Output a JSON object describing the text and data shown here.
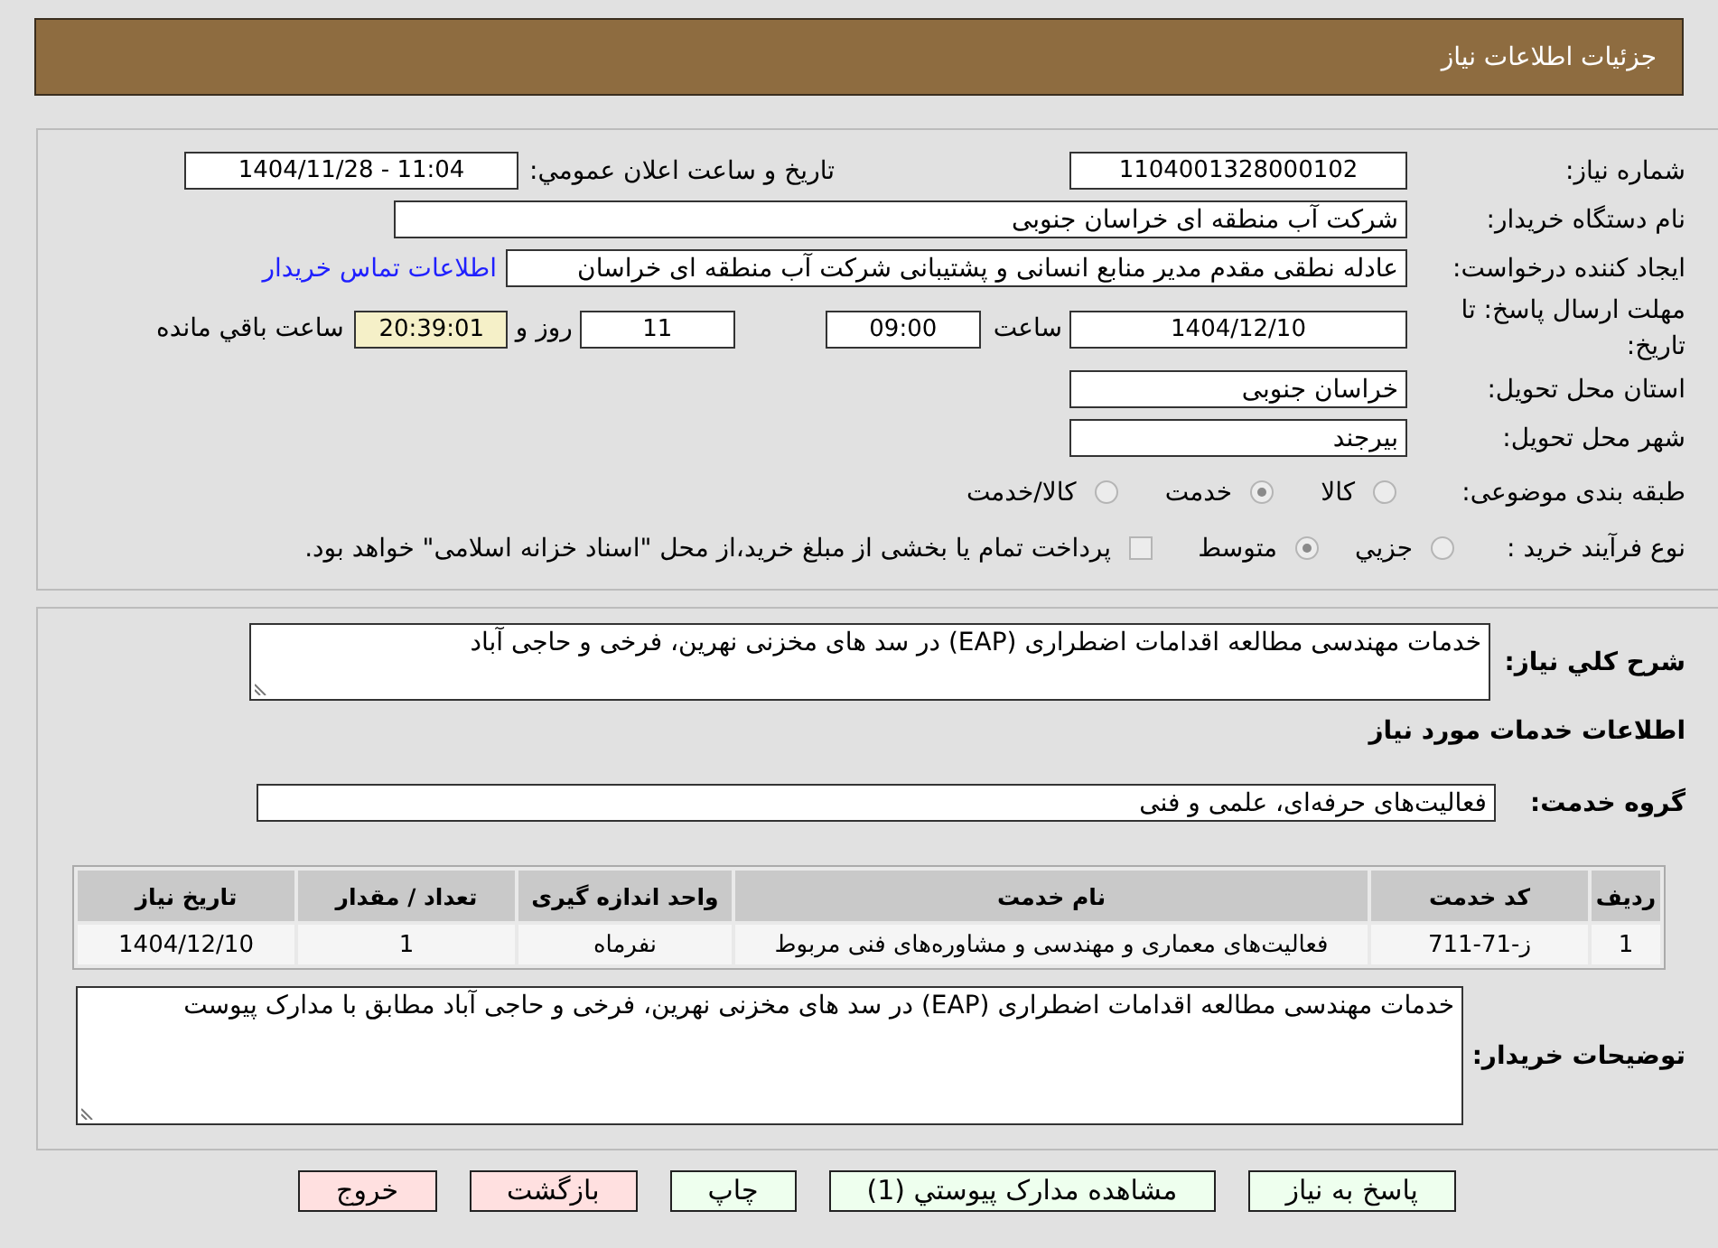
{
  "header": {
    "title": "جزئیات اطلاعات نیاز"
  },
  "need_number": {
    "label": "شماره نیاز:",
    "value": "1104001328000102"
  },
  "announce_datetime": {
    "label": "تاریخ و ساعت اعلان عمومي:",
    "value": "1404/11/28 - 11:04"
  },
  "buyer_org": {
    "label": "نام دستگاه خریدار:",
    "value": "شرکت آب منطقه ای خراسان جنوبی"
  },
  "requester": {
    "label": "ایجاد کننده درخواست:",
    "value": "عادله نطقی مقدم مدیر منابع انسانی و پشتیبانی شرکت آب منطقه ای خراسان",
    "link": "اطلاعات تماس خریدار"
  },
  "deadline": {
    "label": "مهلت ارسال پاسخ: تا تاریخ:",
    "date": "1404/12/10",
    "time_label": "ساعت",
    "time": "09:00",
    "days": "11",
    "days_label": "روز و",
    "remaining": "20:39:01",
    "remaining_label": "ساعت باقي مانده"
  },
  "province": {
    "label": "استان محل تحویل:",
    "value": "خراسان جنوبی"
  },
  "city": {
    "label": "شهر محل تحویل:",
    "value": "بیرجند"
  },
  "category": {
    "label": "طبقه بندی موضوعی:",
    "disabled": true,
    "options": [
      {
        "label": "کالا",
        "selected": false
      },
      {
        "label": "خدمت",
        "selected": true
      },
      {
        "label": "کالا/خدمت",
        "selected": false
      }
    ]
  },
  "purchase_type": {
    "label": "نوع فرآیند خرید :",
    "disabled": true,
    "options": [
      {
        "label": "جزيي",
        "selected": false
      },
      {
        "label": "متوسط",
        "selected": true
      }
    ],
    "treasury": {
      "label": "پرداخت تمام یا بخشی از مبلغ خرید،از محل \"اسناد خزانه اسلامی\" خواهد بود.",
      "checked": false
    }
  },
  "description": {
    "label": "شرح کلي نیاز:",
    "value": "خدمات مهندسی مطالعه اقدامات اضطراری (EAP) در سد های مخزنی نهرین، فرخی و حاجی آباد"
  },
  "services_heading": "اطلاعات خدمات مورد نیاز",
  "service_group": {
    "label": "گروه خدمت:",
    "value": "فعالیت‌های حرفه‌ای، علمی و فنی"
  },
  "table": {
    "columns": [
      "ردیف",
      "کد خدمت",
      "نام خدمت",
      "واحد اندازه گیری",
      "تعداد / مقدار",
      "تاریخ نیاز"
    ],
    "rows": [
      [
        "1",
        "ز-71-711",
        "فعالیت‌های معماری و مهندسی و مشاوره‌های فنی مربوط",
        "نفرماه",
        "1",
        "1404/12/10"
      ]
    ]
  },
  "buyer_notes": {
    "label": "توضیحات خریدار:",
    "value": "خدمات مهندسی مطالعه اقدامات اضطراری (EAP) در سد های مخزنی نهرین، فرخی و حاجی آباد مطابق با مدارک پیوست"
  },
  "buttons": [
    {
      "label": "پاسخ به نیاز",
      "kind": "proceed"
    },
    {
      "label": "مشاهده مدارک پیوستي (1)",
      "kind": "proceed"
    },
    {
      "label": "چاپ",
      "kind": "proceed"
    },
    {
      "label": "بازگشت",
      "kind": "leave"
    },
    {
      "label": "خروج",
      "kind": "leave"
    }
  ]
}
